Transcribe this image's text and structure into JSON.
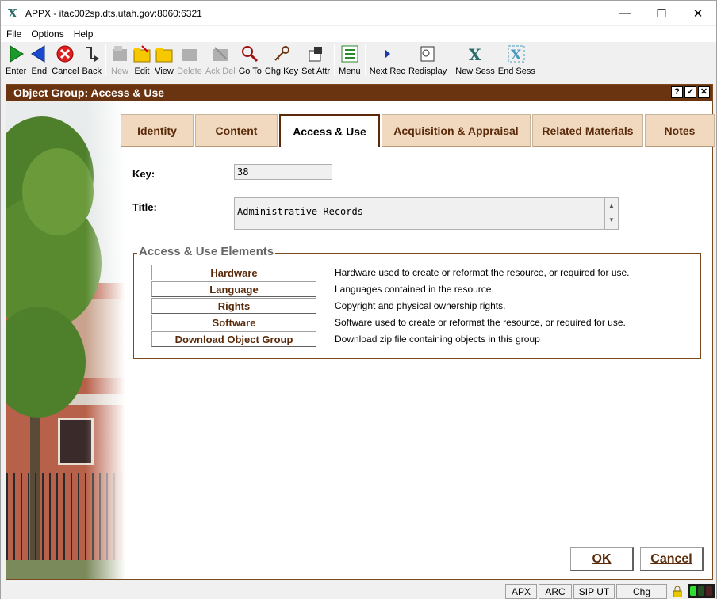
{
  "window": {
    "title": "APPX - itac002sp.dts.utah.gov:8060:6321"
  },
  "menu": [
    "File",
    "Options",
    "Help"
  ],
  "toolbar": [
    {
      "label": "Enter",
      "icon": "enter-arrow-icon",
      "disabled": false
    },
    {
      "label": "End",
      "icon": "end-arrow-icon",
      "disabled": false
    },
    {
      "label": "Cancel",
      "icon": "cancel-icon",
      "disabled": false
    },
    {
      "label": "Back",
      "icon": "back-icon",
      "disabled": false
    },
    {
      "label": "New",
      "icon": "new-icon",
      "disabled": true
    },
    {
      "label": "Edit",
      "icon": "edit-folder-icon",
      "disabled": false
    },
    {
      "label": "View",
      "icon": "view-folder-icon",
      "disabled": false
    },
    {
      "label": "Delete",
      "icon": "delete-icon",
      "disabled": true
    },
    {
      "label": "Ack Del",
      "icon": "ack-delete-icon",
      "disabled": true
    },
    {
      "label": "Go To",
      "icon": "goto-magnifier-icon",
      "disabled": false
    },
    {
      "label": "Chg Key",
      "icon": "change-key-icon",
      "disabled": false
    },
    {
      "label": "Set Attr",
      "icon": "set-attributes-icon",
      "disabled": false
    },
    {
      "label": "Menu",
      "icon": "menu-list-icon",
      "disabled": false
    },
    {
      "label": "Next Rec",
      "icon": "next-record-icon",
      "disabled": false
    },
    {
      "label": "Redisplay",
      "icon": "redisplay-icon",
      "disabled": false
    },
    {
      "label": "New Sess",
      "icon": "new-session-icon",
      "disabled": false
    },
    {
      "label": "End Sess",
      "icon": "end-session-icon",
      "disabled": false
    }
  ],
  "frame": {
    "title": "Object Group:  Access & Use",
    "buttons": [
      "?",
      "✓",
      "✕"
    ]
  },
  "tabs": [
    "Identity",
    "Content",
    "Access & Use",
    "Acquisition & Appraisal",
    "Related Materials",
    "Notes"
  ],
  "active_tab": "Access & Use",
  "form": {
    "key_label": "Key:",
    "key_value": "38",
    "title_label": "Title:",
    "title_value": "Administrative Records"
  },
  "group": {
    "title": "Access & Use Elements",
    "items": [
      {
        "label": "Hardware",
        "desc": "Hardware used to create or reformat the resource, or required for use."
      },
      {
        "label": "Language",
        "desc": "Languages contained in the resource."
      },
      {
        "label": "Rights",
        "desc": "Copyright and physical ownership rights."
      },
      {
        "label": "Software",
        "desc": "Software used to create or reformat the resource, or required for use."
      },
      {
        "label": "Download Object Group",
        "desc": "Download zip file containing objects in this group"
      }
    ]
  },
  "actions": {
    "ok": "OK",
    "cancel": "Cancel"
  },
  "status": [
    "APX",
    "ARC",
    "SIP UT",
    "Chg"
  ],
  "colors": {
    "header": "#6b3410",
    "tab_bg": "#f0d9bf",
    "button_text": "#5a2a0a"
  }
}
